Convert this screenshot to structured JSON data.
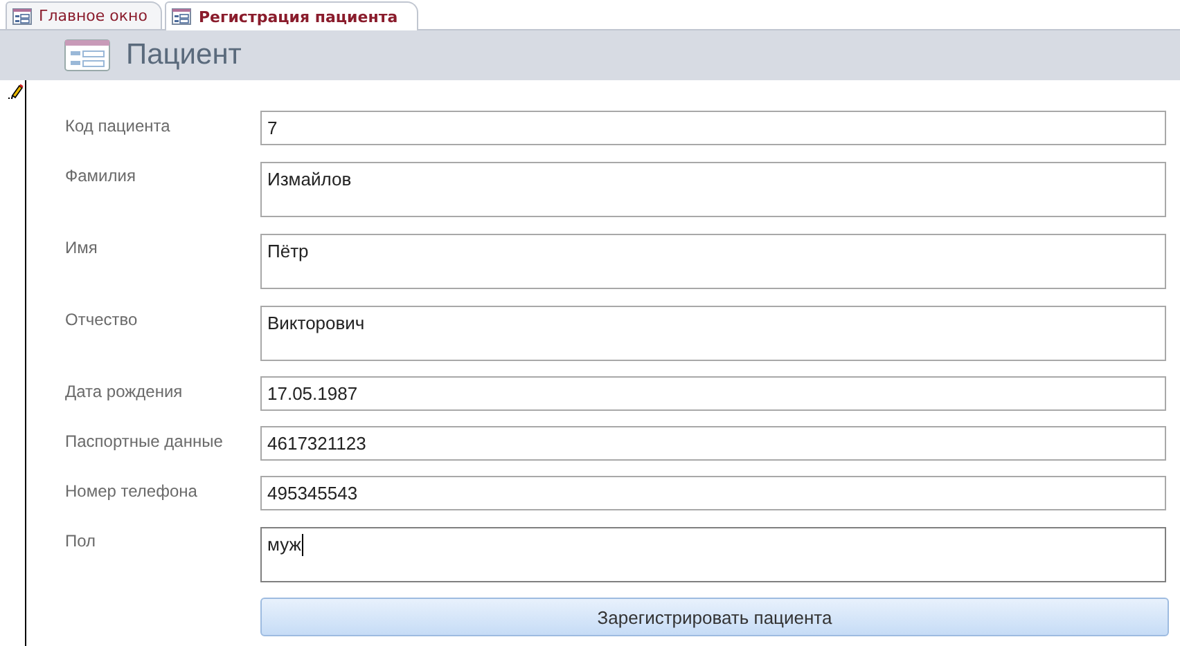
{
  "tabs": [
    {
      "label": "Главное окно",
      "selected": false
    },
    {
      "label": "Регистрация пациента",
      "selected": true
    }
  ],
  "form": {
    "title": "Пациент",
    "fields": [
      {
        "label": "Код пациента",
        "value": "7",
        "kind": "short",
        "focused": false
      },
      {
        "label": "Фамилия",
        "value": "Измайлов",
        "kind": "tall",
        "focused": false
      },
      {
        "label": "Имя",
        "value": "Пётр",
        "kind": "tall",
        "focused": false
      },
      {
        "label": "Отчество",
        "value": "Викторович",
        "kind": "tall",
        "focused": false
      },
      {
        "label": "Дата рождения",
        "value": "17.05.1987",
        "kind": "short",
        "focused": false
      },
      {
        "label": "Паспортные данные",
        "value": "4617321123",
        "kind": "short",
        "focused": false
      },
      {
        "label": "Номер телефона",
        "value": "495345543",
        "kind": "short",
        "focused": false
      },
      {
        "label": "Пол",
        "value": "муж",
        "kind": "tall",
        "focused": true
      }
    ],
    "button": "Зарегистрировать пациента"
  }
}
